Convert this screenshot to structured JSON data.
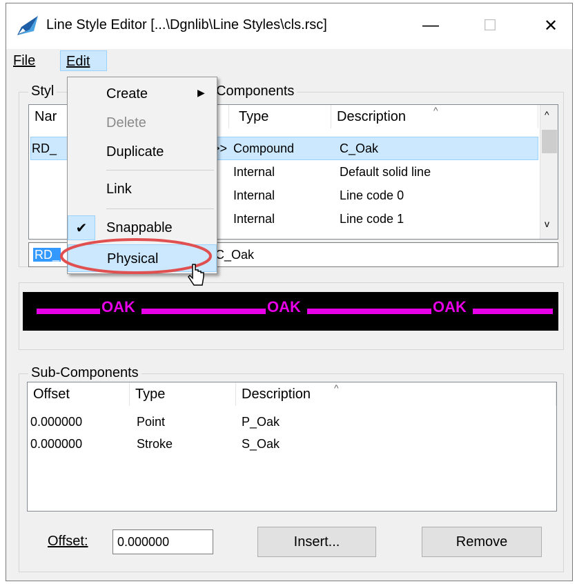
{
  "window": {
    "title": "Line Style Editor [...\\Dgnlib\\Line Styles\\cls.rsc]",
    "minimize_glyph": "—",
    "maximize_glyph": "☐",
    "close_glyph": "✕"
  },
  "menubar": {
    "file": "File",
    "edit": "Edit"
  },
  "styles_group": {
    "label": "Styl",
    "col_name": "Nar",
    "row_name": "RD_",
    "name_input": "RD_"
  },
  "components_group": {
    "label": "Components",
    "columns": [
      "Type",
      "Description"
    ],
    "rows": [
      {
        "marker": ">>",
        "type": "Compound",
        "description": "C_Oak"
      },
      {
        "marker": "",
        "type": "Internal",
        "description": "Default solid line"
      },
      {
        "marker": "",
        "type": "Internal",
        "description": "Line code 0"
      },
      {
        "marker": "",
        "type": "Internal",
        "description": "Line code 1"
      }
    ],
    "description_input": "C_Oak"
  },
  "preview": {
    "labels": [
      "OAK",
      "OAK",
      "OAK"
    ],
    "line_color": "#e800e8",
    "background": "#000000"
  },
  "sub_components": {
    "label": "Sub-Components",
    "columns": [
      "Offset",
      "Type",
      "Description"
    ],
    "rows": [
      {
        "offset": "0.000000",
        "type": "Point",
        "description": "P_Oak"
      },
      {
        "offset": "0.000000",
        "type": "Stroke",
        "description": "S_Oak"
      }
    ]
  },
  "bottom": {
    "offset_label": "Offset:",
    "offset_value": "0.000000",
    "insert": "Insert...",
    "remove": "Remove"
  },
  "edit_menu": {
    "create": "Create",
    "delete": "Delete",
    "duplicate": "Duplicate",
    "link": "Link",
    "snappable": "Snappable",
    "snappable_check": "✔",
    "physical": "Physical",
    "submenu_arrow": "▶"
  },
  "colors": {
    "highlight": "#cce8ff",
    "callout": "#e05050",
    "selection": "#3399ff"
  }
}
